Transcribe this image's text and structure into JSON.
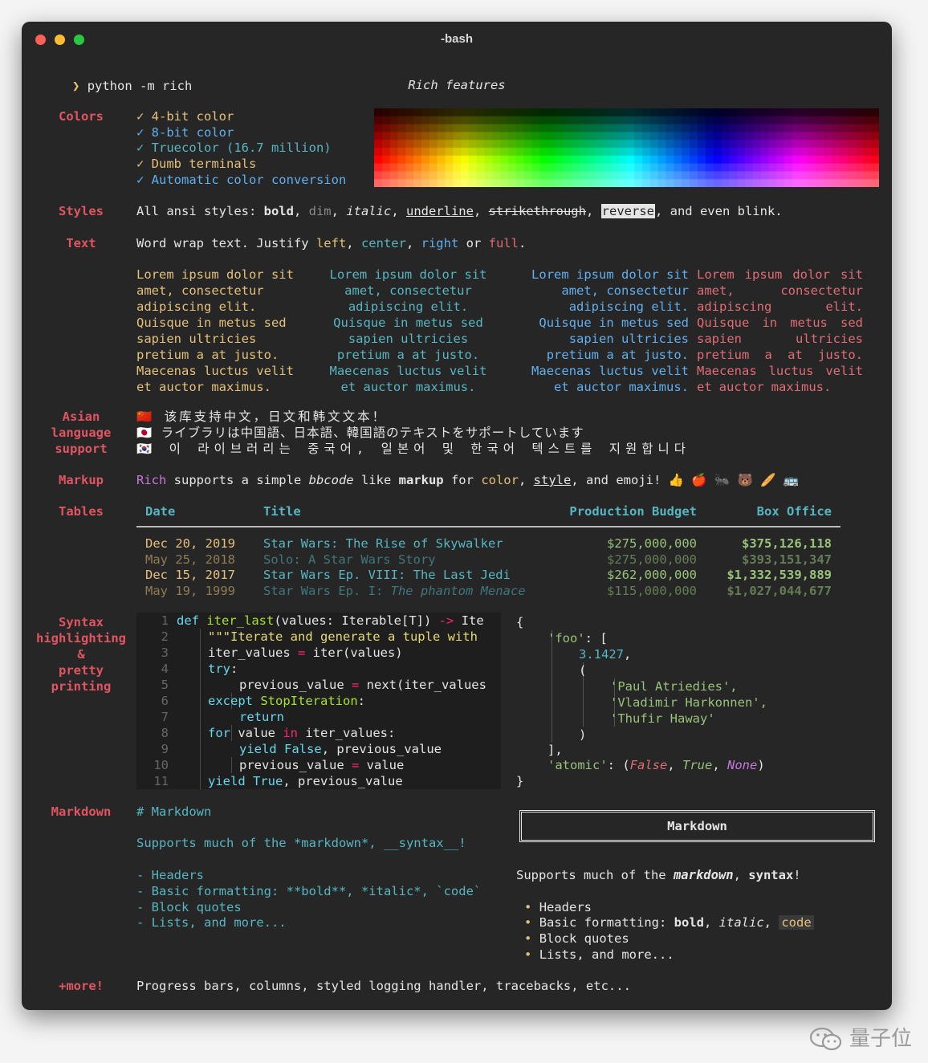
{
  "window": {
    "title": "-bash"
  },
  "prompt": {
    "symbol": "❯",
    "command": "python -m rich"
  },
  "heading": "Rich features",
  "labels": {
    "colors": "Colors",
    "styles": "Styles",
    "text": "Text",
    "asian": [
      "Asian",
      "language",
      "support"
    ],
    "markup": "Markup",
    "tables": "Tables",
    "syntax": [
      "Syntax",
      "highlighting",
      "&",
      "pretty",
      "printing"
    ],
    "markdown": "Markdown",
    "more": "+more!"
  },
  "colors": {
    "items": [
      {
        "text": "✓ 4-bit color",
        "color": "#e5c07b"
      },
      {
        "text": "✓ 8-bit color",
        "color": "#61afef"
      },
      {
        "text": "✓ Truecolor (16.7 million)",
        "color": "#56b6c2"
      },
      {
        "text": "✓ Dumb terminals",
        "color": "#e5c07b"
      },
      {
        "text": "✓ Automatic color conversion",
        "color": "#61afef"
      }
    ]
  },
  "styles": {
    "prefix": "All ansi styles: ",
    "bold": "bold",
    "dim": "dim",
    "italic": "italic",
    "underline": "underline",
    "strike": "strikethrough",
    "reverse": "reverse",
    "suffix": ", and even blink.",
    "sep": ", "
  },
  "text": {
    "line": [
      "Word wrap text. Justify ",
      "left",
      ", ",
      "center",
      ", ",
      "right",
      " or ",
      "full",
      "."
    ],
    "lorem": [
      "Lorem ipsum dolor sit",
      "amet, consectetur",
      "adipiscing elit.",
      "Quisque in metus sed",
      "sapien ultricies",
      "pretium a at justo.",
      "Maecenas luctus velit",
      "et auctor maximus."
    ]
  },
  "asian": {
    "lines": [
      {
        "flag": "🇨🇳",
        "text": "该库支持中文，日文和韩文文本！"
      },
      {
        "flag": "🇯🇵",
        "text": "ライブラリは中国語、日本語、韓国語のテキストをサポートしています"
      },
      {
        "flag": "🇰🇷",
        "text": "이 라이브러리는 중국어, 일본어 및 한국어 텍스트를 지원합니다"
      }
    ]
  },
  "markup": {
    "parts": [
      "Rich",
      " supports a simple ",
      "bbcode",
      " like ",
      "markup",
      " for ",
      "color",
      ", ",
      "style",
      ", and emoji! "
    ],
    "emoji": "👍 🍎 🐜 🐻 🥖 🚌"
  },
  "table": {
    "headers": [
      "Date",
      "Title",
      "Production Budget",
      "Box Office"
    ],
    "rows": [
      {
        "date": "Dec 20, 2019",
        "title": "Star Wars: The Rise of Skywalker",
        "budget": "$275,000,000",
        "box": "$375,126,118"
      },
      {
        "date": "May 25, 2018",
        "title": "Solo: A Star Wars Story",
        "budget": "$275,000,000",
        "box": "$393,151,347"
      },
      {
        "date": "Dec 15, 2017",
        "title": "Star Wars Ep. VIII: The Last Jedi",
        "budget": "$262,000,000",
        "box": "$1,332,539,889"
      },
      {
        "date": "May 19, 1999",
        "title_a": "Star Wars Ep. I: ",
        "title_b": "The phantom Menace",
        "budget": "$115,000,000",
        "box": "$1,027,044,677"
      }
    ]
  },
  "code": {
    "nums": [
      "1",
      "2",
      "3",
      "4",
      "5",
      "6",
      "7",
      "8",
      "9",
      "10",
      "11"
    ],
    "l1": [
      "def",
      " ",
      "iter_last",
      "(values: Iterable[T]) ",
      "->",
      " Ite"
    ],
    "l2": "\"\"\"Iterate and generate a tuple with",
    "l3": [
      "iter_values ",
      "=",
      " iter(values)"
    ],
    "l4": [
      "try",
      ":"
    ],
    "l5": [
      "previous_value ",
      "=",
      " next(iter_values"
    ],
    "l6": [
      "except",
      " ",
      "StopIteration",
      ":"
    ],
    "l7": "return",
    "l8": [
      "for",
      " value ",
      "in",
      " iter_values:"
    ],
    "l9": [
      "yield",
      " ",
      "False",
      ", previous_value"
    ],
    "l10": [
      "previous_value ",
      "=",
      " value"
    ],
    "l11": [
      "yield",
      " ",
      "True",
      ", previous_value"
    ]
  },
  "pretty": {
    "open": "{",
    "foo_key": "'foo'",
    "colon_bracket": ": [",
    "num": "3.1427",
    "comma": ",",
    "paren_open": "(",
    "names": [
      "'Paul Atriedies',",
      "'Vladimir Harkonnen',",
      "'Thufir Haway'"
    ],
    "paren_close": ")",
    "bracket_close": "],",
    "atomic_key": "'atomic'",
    "colon_paren": ": (",
    "false": "False",
    "true": "True",
    "none": "None",
    "sep": ", ",
    "close_paren": ")",
    "close": "}"
  },
  "markdown": {
    "src_title": "# Markdown",
    "src_line": "Supports much of the *markdown*, __syntax__!",
    "src_items": [
      "- Headers",
      "- Basic formatting: **bold**, *italic*, `code`",
      "- Block quotes",
      "- Lists, and more..."
    ],
    "box_title": "Markdown",
    "render_line": [
      "Supports much of the ",
      "markdown",
      ", ",
      "syntax",
      "!"
    ],
    "bullet": "•",
    "render_items": [
      "Headers",
      "Block quotes",
      "Lists, and more..."
    ],
    "fmt": [
      "Basic formatting: ",
      "bold",
      ", ",
      "italic",
      ", ",
      "code"
    ]
  },
  "more": "Progress bars, columns, styled logging handler, tracebacks, etc...",
  "watermark": "量子位"
}
